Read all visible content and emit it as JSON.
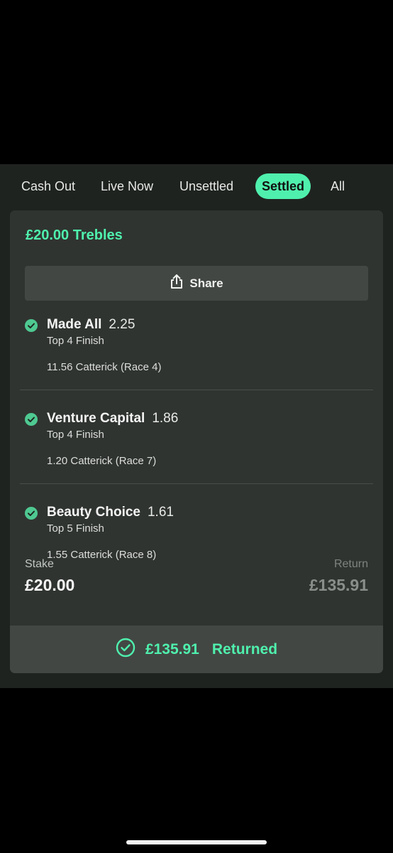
{
  "tabs": [
    {
      "label": "Cash Out",
      "active": false
    },
    {
      "label": "Live Now",
      "active": false
    },
    {
      "label": "Unsettled",
      "active": false
    },
    {
      "label": "Settled",
      "active": true
    },
    {
      "label": "All",
      "active": false
    }
  ],
  "bet": {
    "title": "£20.00 Trebles",
    "share_label": "Share",
    "selections": [
      {
        "name": "Made All",
        "odds": "2.25",
        "market": "Top 4 Finish",
        "event": "11.56 Catterick (Race 4)",
        "status": "won"
      },
      {
        "name": "Venture Capital",
        "odds": "1.86",
        "market": "Top 4 Finish",
        "event": "1.20 Catterick (Race 7)",
        "status": "won"
      },
      {
        "name": "Beauty Choice",
        "odds": "1.61",
        "market": "Top 5 Finish",
        "event": "1.55 Catterick (Race 8)",
        "status": "won"
      }
    ],
    "stake_label": "Stake",
    "stake_value": "£20.00",
    "return_label": "Return",
    "return_value": "£135.91",
    "returned_amount": "£135.91",
    "returned_word": "Returned"
  },
  "colors": {
    "accent": "#4ff0ad",
    "background": "#1f2320",
    "card": "#303431",
    "button": "#434744"
  }
}
